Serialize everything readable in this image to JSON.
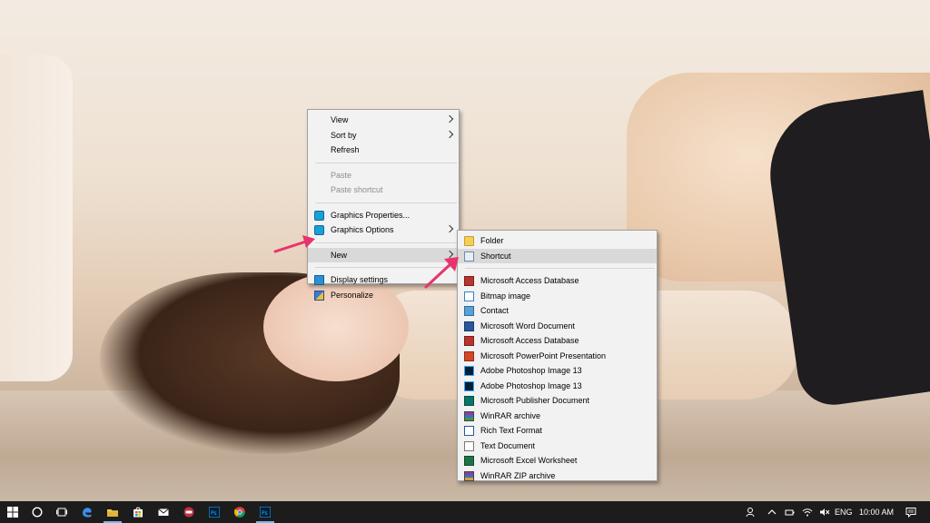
{
  "desktop": {
    "wallpaper": "wallpaper-photo"
  },
  "context_menu": {
    "items": [
      {
        "label": "View",
        "submenu": true
      },
      {
        "label": "Sort by",
        "submenu": true
      },
      {
        "label": "Refresh"
      },
      {
        "label": "Paste",
        "disabled": true
      },
      {
        "label": "Paste shortcut",
        "disabled": true
      },
      {
        "label": "Graphics Properties...",
        "icon": "graphics-icon"
      },
      {
        "label": "Graphics Options",
        "icon": "graphics-options-icon",
        "submenu": true
      },
      {
        "label": "New",
        "submenu": true,
        "highlighted": true
      },
      {
        "label": "Display settings",
        "icon": "display-icon"
      },
      {
        "label": "Personalize",
        "icon": "personalize-icon"
      }
    ]
  },
  "new_submenu": {
    "items": [
      {
        "label": "Folder",
        "icon": "folder-icon"
      },
      {
        "label": "Shortcut",
        "icon": "shortcut-icon",
        "highlighted": true
      },
      {
        "label": "Microsoft Access Database",
        "icon": "access-icon"
      },
      {
        "label": "Bitmap image",
        "icon": "bitmap-icon"
      },
      {
        "label": "Contact",
        "icon": "contact-icon"
      },
      {
        "label": "Microsoft Word Document",
        "icon": "word-icon"
      },
      {
        "label": "Microsoft Access Database",
        "icon": "access-icon"
      },
      {
        "label": "Microsoft PowerPoint Presentation",
        "icon": "powerpoint-icon"
      },
      {
        "label": "Adobe Photoshop Image 13",
        "icon": "photoshop-icon"
      },
      {
        "label": "Adobe Photoshop Image 13",
        "icon": "photoshop-icon"
      },
      {
        "label": "Microsoft Publisher Document",
        "icon": "publisher-icon"
      },
      {
        "label": "WinRAR archive",
        "icon": "winrar-icon"
      },
      {
        "label": "Rich Text Format",
        "icon": "rtf-icon"
      },
      {
        "label": "Text Document",
        "icon": "text-document-icon"
      },
      {
        "label": "Microsoft Excel Worksheet",
        "icon": "excel-icon"
      },
      {
        "label": "WinRAR ZIP archive",
        "icon": "winrar-zip-icon"
      }
    ]
  },
  "annotation": {
    "arrow_color": "#e8336d"
  },
  "taskbar": {
    "pinned": [
      "start-icon",
      "cortana-icon",
      "task-view-icon",
      "edge-icon",
      "file-explorer-icon",
      "store-icon",
      "mail-icon",
      "app-icon",
      "photoshop-icon",
      "chrome-icon",
      "photoshop-icon"
    ],
    "tray": {
      "language": "ENG",
      "time": "10:00 AM"
    },
    "accent": "#76b9ed"
  }
}
